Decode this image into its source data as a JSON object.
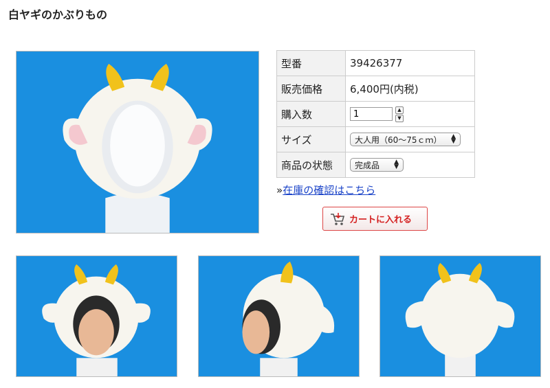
{
  "page_title": "白ヤギのかぶりもの",
  "spec": {
    "model_label": "型番",
    "model_value": "39426377",
    "price_label": "販売価格",
    "price_value": "6,400円(内税)",
    "qty_label": "購入数",
    "qty_value": "1",
    "size_label": "サイズ",
    "size_value": "大人用（60〜75ｃｍ）",
    "state_label": "商品の状態",
    "state_value": "完成品"
  },
  "stock_prefix": "»",
  "stock_link": "在庫の確認はこちら",
  "cart_button": "カートに入れる",
  "icons": {
    "cart": "cart-icon",
    "stepper_up": "stepper-up-icon",
    "stepper_down": "stepper-down-icon"
  },
  "colors": {
    "photo_background": "#1a8fe0",
    "cart_label": "#d42020",
    "link": "#1a43c8"
  }
}
